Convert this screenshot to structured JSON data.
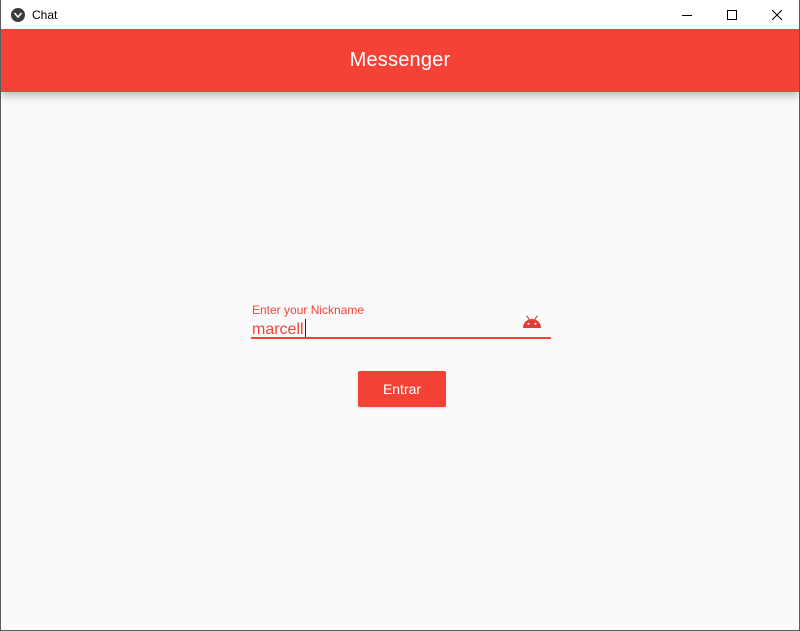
{
  "window": {
    "title": "Chat",
    "controls": [
      "minimize-icon",
      "maximize-icon",
      "close-icon"
    ]
  },
  "appbar": {
    "title": "Messenger"
  },
  "nickname_field": {
    "label": "Enter your Nickname",
    "value": "marcell",
    "icon": "android-icon"
  },
  "enter_button": {
    "label": "Entrar"
  },
  "colors": {
    "primary": "#f44336",
    "background": "#fafafa",
    "icon_red": "#e53935"
  }
}
